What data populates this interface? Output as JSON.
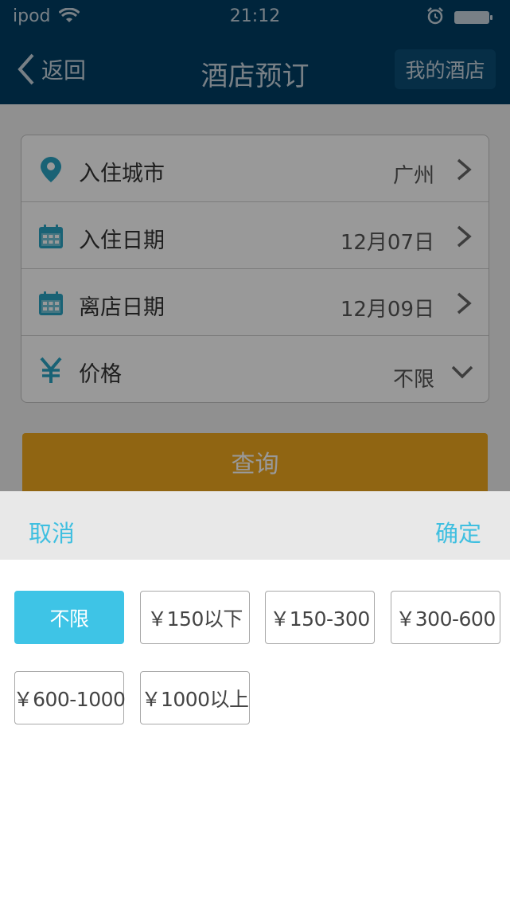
{
  "status_bar": {
    "carrier": "ipod",
    "time": "21:12"
  },
  "nav": {
    "back_label": "返回",
    "title": "酒店预订",
    "right_button": "我的酒店"
  },
  "form": {
    "rows": [
      {
        "label": "入住城市",
        "value": "广州",
        "icon": "location-pin-icon",
        "indicator": "chevron-right-icon"
      },
      {
        "label": "入住日期",
        "value": "12月07日",
        "icon": "calendar-icon",
        "indicator": "chevron-right-icon"
      },
      {
        "label": "离店日期",
        "value": "12月09日",
        "icon": "calendar-icon",
        "indicator": "chevron-right-icon"
      },
      {
        "label": "价格",
        "value": "不限",
        "icon": "yen-icon",
        "indicator": "chevron-down-icon"
      }
    ],
    "query_button": "查询"
  },
  "picker": {
    "cancel": "取消",
    "confirm": "确定",
    "options": [
      "不限",
      "￥150以下",
      "￥150-300",
      "￥300-600",
      "￥600-1000",
      "￥1000以上"
    ],
    "selected": "不限"
  },
  "colors": {
    "nav_bg": "#003e65",
    "accent": "#3ec4e6",
    "query_button": "#f1a81f",
    "icon": "#2aa3c4"
  }
}
